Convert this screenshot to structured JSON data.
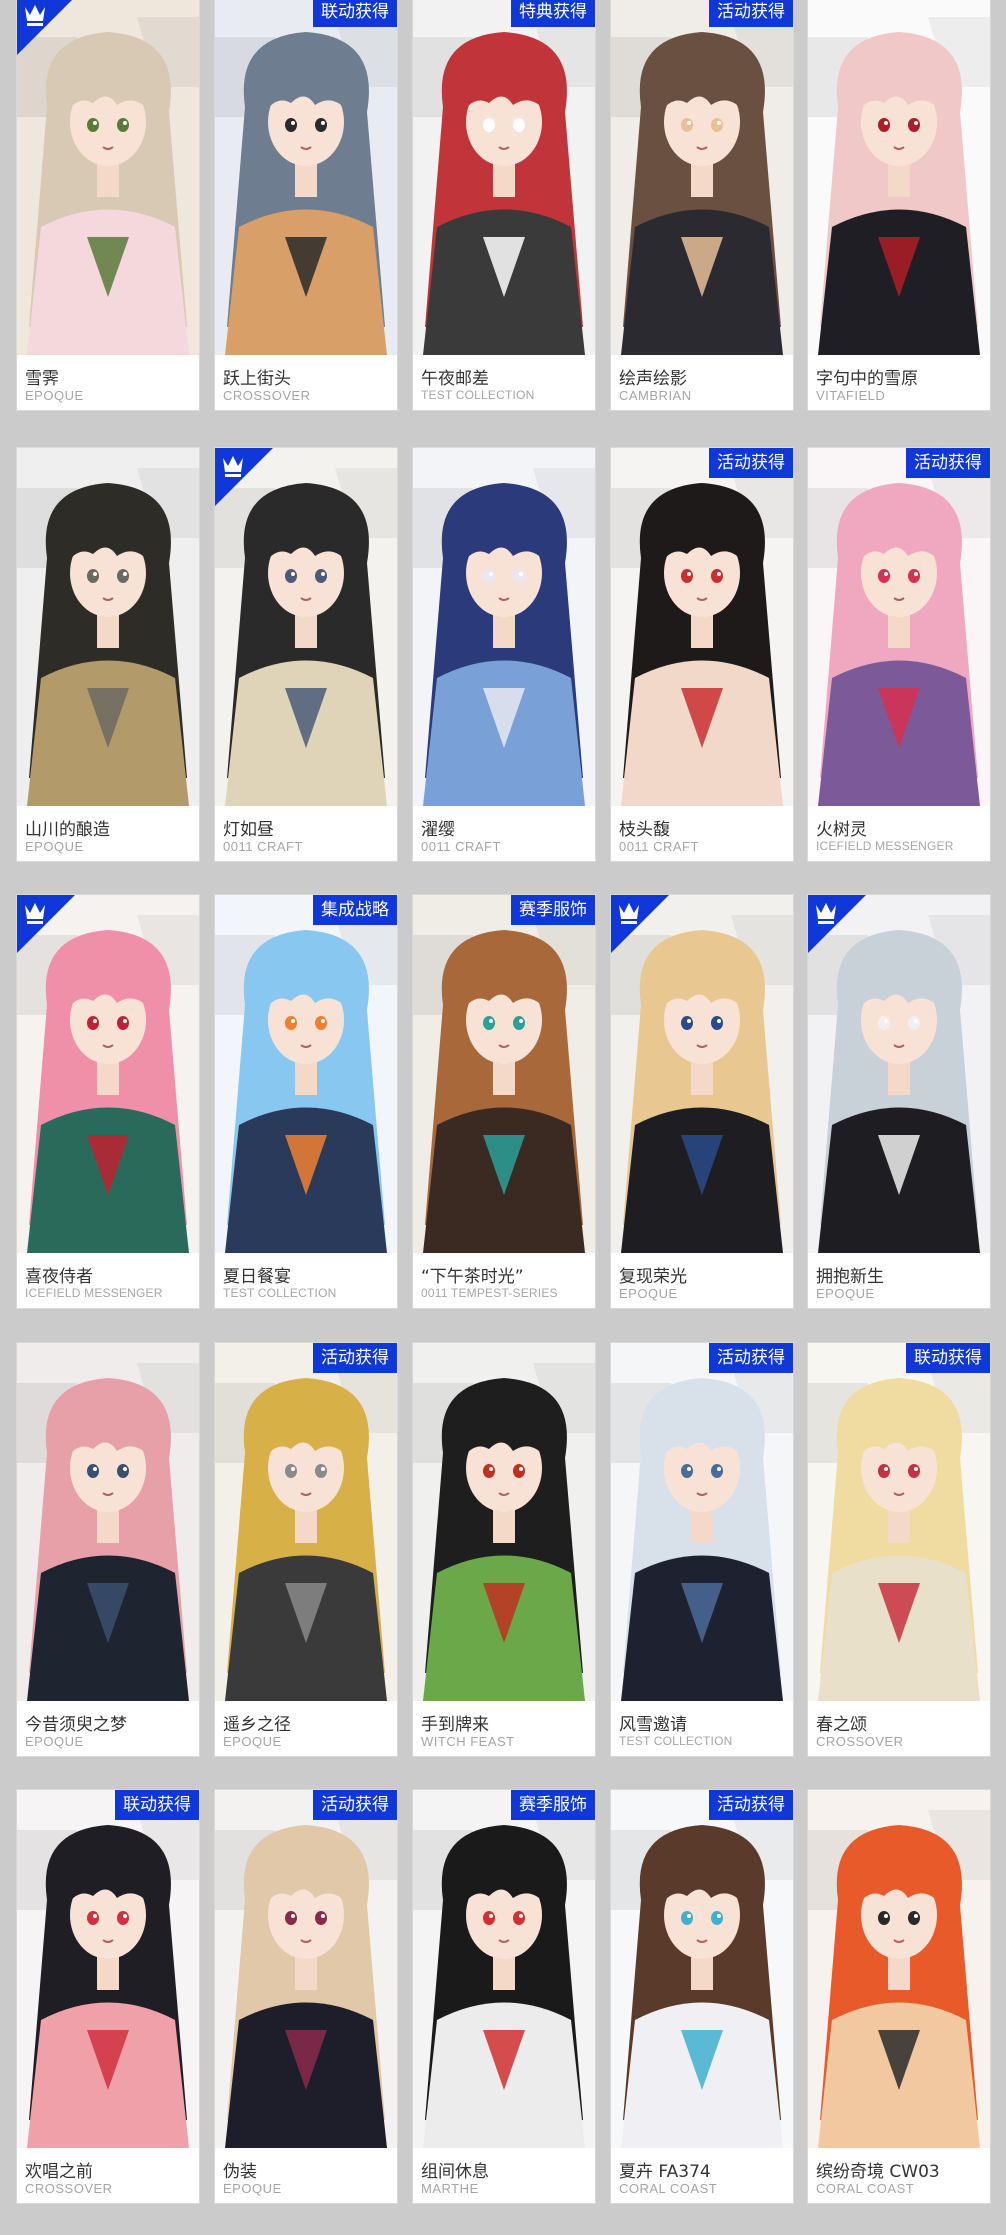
{
  "colors": {
    "page_background": "#cbcbcb",
    "badge_blue": "#1038d8",
    "name_text": "#333333",
    "brand_text": "#a5a5a5"
  },
  "cards": [
    {
      "name": "雪霁",
      "brand": "EPOQUE",
      "badge": "",
      "corner_icon": "crown-icon",
      "palette": [
        "#efe6dc",
        "#d8c9b5",
        "#f5d8dc",
        "#5a7a3a"
      ]
    },
    {
      "name": "跃上街头",
      "brand": "CROSSOVER",
      "badge": "联动获得",
      "corner_icon": "",
      "palette": [
        "#e8ecf2",
        "#6e7e90",
        "#d8a068",
        "#2a2a2a"
      ]
    },
    {
      "name": "午夜邮差",
      "brand": "TEST COLLECTION",
      "badge": "特典获得",
      "corner_icon": "",
      "palette": [
        "#f2f2f2",
        "#c0343a",
        "#3a3a3a",
        "#ffffff"
      ]
    },
    {
      "name": "绘声绘影",
      "brand": "CAMBRIAN",
      "badge": "活动获得",
      "corner_icon": "",
      "palette": [
        "#f0ece8",
        "#6a5040",
        "#2a2a30",
        "#e8c098"
      ]
    },
    {
      "name": "字句中的雪原",
      "brand": "VITAFIELD",
      "badge": "",
      "corner_icon": "",
      "palette": [
        "#fafafa",
        "#f0c8c8",
        "#1e1e24",
        "#b01c24"
      ]
    },
    {
      "name": "山川的酿造",
      "brand": "EPOQUE",
      "badge": "",
      "corner_icon": "",
      "palette": [
        "#efefef",
        "#2e2c26",
        "#b29a6a",
        "#6b6a62"
      ]
    },
    {
      "name": "灯如昼",
      "brand": "0011 CRAFT",
      "badge": "",
      "corner_icon": "crown-icon",
      "palette": [
        "#f4f2ee",
        "#2a2a2a",
        "#e0d4b8",
        "#4a5a78"
      ]
    },
    {
      "name": "濯缨",
      "brand": "0011 CRAFT",
      "badge": "",
      "corner_icon": "",
      "palette": [
        "#f2f4f8",
        "#2a3a7a",
        "#7aa0d8",
        "#e8e8f0"
      ]
    },
    {
      "name": "枝头馥",
      "brand": "0011 CRAFT",
      "badge": "活动获得",
      "corner_icon": "",
      "palette": [
        "#f6f4f2",
        "#1e1a1a",
        "#f2d8c8",
        "#c83030"
      ]
    },
    {
      "name": "火树灵",
      "brand": "ICEFIELD MESSENGER",
      "badge": "活动获得",
      "corner_icon": "",
      "palette": [
        "#faf6f8",
        "#f0a8c0",
        "#7c5a9a",
        "#d83050"
      ]
    },
    {
      "name": "喜夜侍者",
      "brand": "ICEFIELD MESSENGER",
      "badge": "",
      "corner_icon": "crown-icon",
      "palette": [
        "#f6f2f0",
        "#f090a8",
        "#2a6a5a",
        "#c02030"
      ]
    },
    {
      "name": "夏日餐宴",
      "brand": "TEST COLLECTION",
      "badge": "集成战略",
      "corner_icon": "",
      "palette": [
        "#f2f6fa",
        "#88c8f0",
        "#2a3a5a",
        "#f08030"
      ]
    },
    {
      "name": "“下午茶时光”",
      "brand": "0011 TEMPEST-SERIES",
      "badge": "赛季服饰",
      "corner_icon": "",
      "palette": [
        "#f0ece6",
        "#a8683a",
        "#3a2a22",
        "#2aa098"
      ]
    },
    {
      "name": "复现荣光",
      "brand": "EPOQUE",
      "badge": "",
      "corner_icon": "crown-icon",
      "palette": [
        "#f2f0ec",
        "#e8c890",
        "#1e1e22",
        "#2a4a8a"
      ]
    },
    {
      "name": "拥抱新生",
      "brand": "EPOQUE",
      "badge": "",
      "corner_icon": "crown-icon",
      "palette": [
        "#f2f2f4",
        "#c8d0d8",
        "#1e1e22",
        "#f0f0f0"
      ]
    },
    {
      "name": "今昔须臾之梦",
      "brand": "EPOQUE",
      "badge": "",
      "corner_icon": "",
      "palette": [
        "#f0ecec",
        "#e8a0a8",
        "#1e2430",
        "#3a5070"
      ]
    },
    {
      "name": "遥乡之径",
      "brand": "EPOQUE",
      "badge": "活动获得",
      "corner_icon": "",
      "palette": [
        "#f2f0e8",
        "#d8b048",
        "#3a3a3a",
        "#8a8a8a"
      ]
    },
    {
      "name": "手到牌来",
      "brand": "WITCH FEAST",
      "badge": "",
      "corner_icon": "",
      "palette": [
        "#f0f0ee",
        "#1e1e1e",
        "#6aa84a",
        "#c03020"
      ]
    },
    {
      "name": "风雪邀请",
      "brand": "TEST COLLECTION",
      "badge": "活动获得",
      "corner_icon": "",
      "palette": [
        "#f4f6f8",
        "#d8e0ea",
        "#1e2230",
        "#4a6a9a"
      ]
    },
    {
      "name": "春之颂",
      "brand": "CROSSOVER",
      "badge": "联动获得",
      "corner_icon": "",
      "palette": [
        "#f8f6f0",
        "#f0dca0",
        "#e8e0c8",
        "#c83040"
      ]
    },
    {
      "name": "欢唱之前",
      "brand": "CROSSOVER",
      "badge": "联动获得",
      "corner_icon": "",
      "palette": [
        "#f6f4f4",
        "#1e1e24",
        "#f0a0a8",
        "#d03040"
      ]
    },
    {
      "name": "伪装",
      "brand": "EPOQUE",
      "badge": "活动获得",
      "corner_icon": "",
      "palette": [
        "#f4f2f0",
        "#e0c8a8",
        "#1e1e2a",
        "#8a2a4a"
      ]
    },
    {
      "name": "组间休息",
      "brand": "MARTHE",
      "badge": "赛季服饰",
      "corner_icon": "",
      "palette": [
        "#f4f4f4",
        "#1a1a1a",
        "#ececec",
        "#d03030"
      ]
    },
    {
      "name": "夏卉 FA374",
      "brand": "CORAL COAST",
      "badge": "活动获得",
      "corner_icon": "",
      "palette": [
        "#f6f8fa",
        "#5a3a2a",
        "#f0f0f4",
        "#40b0d0"
      ]
    },
    {
      "name": "缤纷奇境 CW03",
      "brand": "CORAL COAST",
      "badge": "",
      "corner_icon": "",
      "palette": [
        "#f8f2ee",
        "#e85a2a",
        "#f2c8a0",
        "#2a2a2a"
      ]
    }
  ]
}
